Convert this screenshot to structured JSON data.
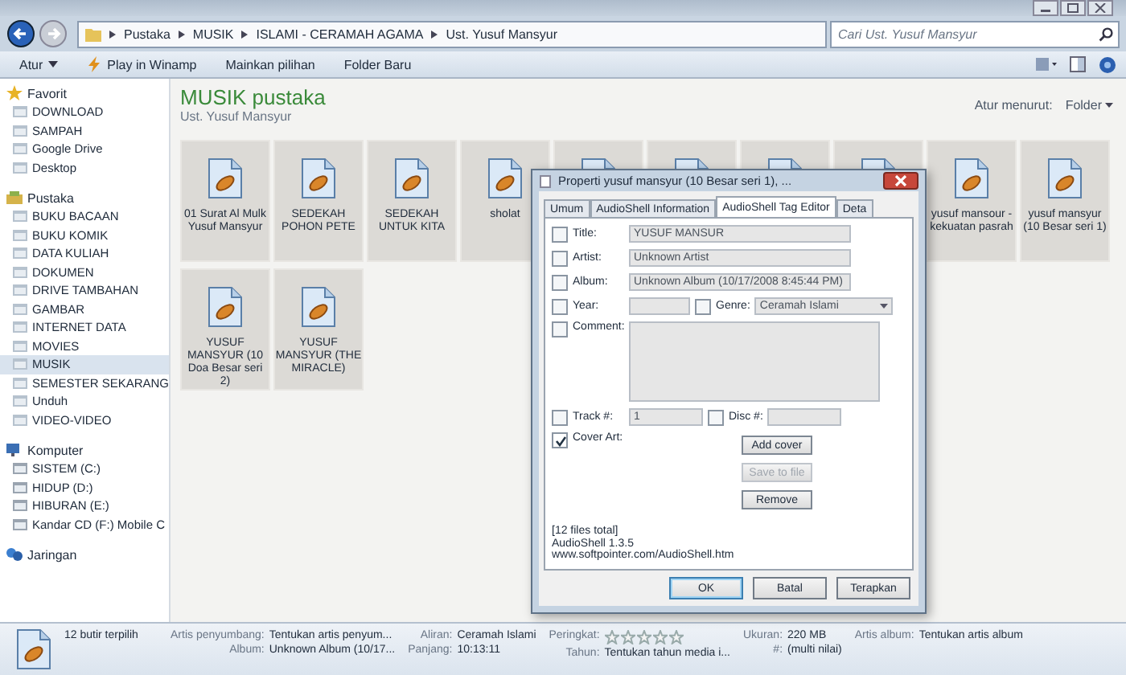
{
  "breadcrumb": [
    "Pustaka",
    "MUSIK",
    "ISLAMI - CERAMAH AGAMA",
    "Ust. Yusuf Mansyur"
  ],
  "search": {
    "placeholder": "Cari Ust. Yusuf Mansyur"
  },
  "toolbar": [
    {
      "label": "Atur",
      "kind": "menu"
    },
    {
      "label": "Play in Winamp",
      "kind": "icon"
    },
    {
      "label": "Mainkan pilihan",
      "kind": "plain"
    },
    {
      "label": "Folder Baru",
      "kind": "plain"
    }
  ],
  "sidebar": [
    {
      "label": "Favorit",
      "kind": "favorites",
      "items": [
        {
          "label": "DOWNLOAD",
          "selected": false
        },
        {
          "label": "SAMPAH",
          "selected": false
        },
        {
          "label": "Google Drive",
          "selected": false
        },
        {
          "label": "Desktop",
          "selected": false
        }
      ]
    },
    {
      "label": "Pustaka",
      "kind": "libraries",
      "items": [
        {
          "label": "BUKU BACAAN",
          "selected": false
        },
        {
          "label": "BUKU KOMIK",
          "selected": false
        },
        {
          "label": "DATA KULIAH",
          "selected": false
        },
        {
          "label": "DOKUMEN",
          "selected": false
        },
        {
          "label": "DRIVE TAMBAHAN",
          "selected": false
        },
        {
          "label": "GAMBAR",
          "selected": false
        },
        {
          "label": "INTERNET DATA",
          "selected": false
        },
        {
          "label": "MOVIES",
          "selected": false
        },
        {
          "label": "MUSIK",
          "selected": true
        },
        {
          "label": "SEMESTER SEKARANG",
          "selected": false
        },
        {
          "label": "Unduh",
          "selected": false
        },
        {
          "label": "VIDEO-VIDEO",
          "selected": false
        }
      ]
    },
    {
      "label": "Komputer",
      "kind": "computer",
      "items": [
        {
          "label": "SISTEM (C:)",
          "selected": false
        },
        {
          "label": "HIDUP (D:)",
          "selected": false
        },
        {
          "label": "HIBURAN (E:)",
          "selected": false
        },
        {
          "label": "Kandar CD (F:) Mobile C",
          "selected": false
        }
      ]
    },
    {
      "label": "Jaringan",
      "kind": "network"
    }
  ],
  "library": {
    "title": "MUSIK pustaka",
    "subtitle": "Ust. Yusuf Mansyur",
    "arrange_label": "Atur menurut:",
    "arrange_value": "Folder"
  },
  "files": [
    {
      "label": "01 Surat Al Mulk Yusuf Mansyur",
      "selected": true
    },
    {
      "label": "SEDEKAH POHON PETE",
      "selected": true
    },
    {
      "label": "SEDEKAH UNTUK KITA",
      "selected": true
    },
    {
      "label": "sholat",
      "selected": true
    },
    {
      "selected": true
    },
    {
      "selected": true
    },
    {
      "selected": true
    },
    {
      "selected": true
    },
    {
      "label": "yusuf mansour - kekuatan pasrah",
      "selected": true
    },
    {
      "label": "yusuf mansyur (10 Besar seri 1)",
      "selected": true
    },
    {
      "label": "YUSUF MANSYUR (10 Doa Besar seri 2)",
      "selected": true
    },
    {
      "label": "YUSUF MANSYUR (THE MIRACLE)",
      "selected": true
    }
  ],
  "dialog": {
    "title": "Properti yusuf mansyur (10 Besar seri 1), ...",
    "tabs": [
      {
        "label": "Umum",
        "selected": false
      },
      {
        "label": "AudioShell Information",
        "selected": false
      },
      {
        "label": "AudioShell Tag Editor",
        "selected": true
      },
      {
        "label": "Deta",
        "selected": false
      }
    ],
    "text_fields": [
      {
        "label": "Title:",
        "value": "YUSUF MANSUR",
        "checked": false
      },
      {
        "label": "Artist:",
        "value": "Unknown Artist",
        "checked": false
      },
      {
        "label": "Album:",
        "value": "Unknown Album (10/17/2008 8:45:44 PM)",
        "checked": false
      }
    ],
    "year": {
      "label": "Year:",
      "checked": false
    },
    "genre": {
      "label": "Genre:",
      "value": "Ceramah Islami",
      "checked": false
    },
    "comment": {
      "label": "Comment:",
      "checked": false
    },
    "track": {
      "label": "Track #:",
      "value": "1",
      "checked": false
    },
    "disc": {
      "label": "Disc #:",
      "checked": false
    },
    "cover_art": {
      "label": "Cover Art:",
      "checked": true
    },
    "cover_buttons": [
      {
        "label": "Add cover",
        "disabled": false
      },
      {
        "label": "Save to file",
        "disabled": true
      },
      {
        "label": "Remove",
        "disabled": false
      }
    ],
    "info_lines": [
      "[12 files total]",
      "AudioShell 1.3.5",
      "www.softpointer.com/AudioShell.htm"
    ],
    "buttons": [
      {
        "label": "OK",
        "default": true
      },
      {
        "label": "Batal",
        "default": false
      },
      {
        "label": "Terapkan",
        "default": false
      }
    ]
  },
  "details": {
    "count": "12 butir terpilih",
    "columns": [
      [
        {
          "label": "Artis penyumbang:",
          "value": "Tentukan artis penyum...",
          "kind": "text"
        },
        {
          "label": "Album:",
          "value": "Unknown Album (10/17...",
          "kind": "text"
        }
      ],
      [
        {
          "label": "Aliran:",
          "value": "Ceramah Islami",
          "kind": "text"
        },
        {
          "label": "Panjang:",
          "value": "10:13:11",
          "kind": "text"
        }
      ],
      [
        {
          "label": "Peringkat:",
          "stars": 0,
          "kind": "stars"
        },
        {
          "label": "Tahun:",
          "value": "Tentukan tahun media i...",
          "kind": "text"
        }
      ],
      [
        {
          "label": "Ukuran:",
          "value": "220 MB",
          "kind": "text"
        },
        {
          "label": "#:",
          "value": "(multi nilai)",
          "kind": "text"
        }
      ],
      [
        {
          "label": "Artis album:",
          "value": "Tentukan artis album",
          "kind": "text"
        }
      ]
    ]
  }
}
